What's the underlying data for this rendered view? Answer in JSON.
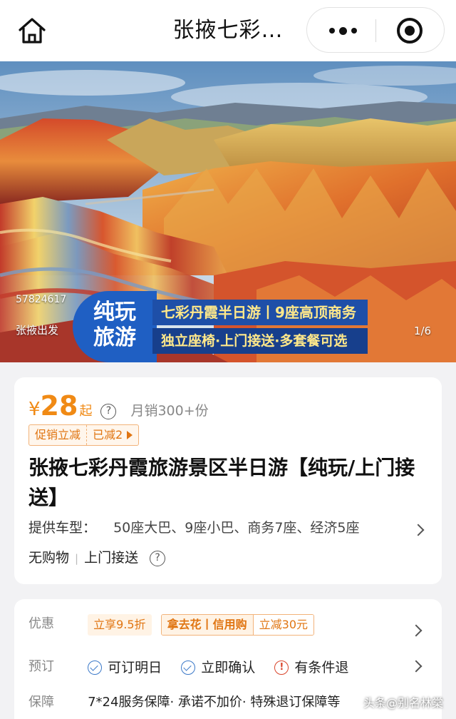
{
  "header": {
    "title": "张掖七彩…",
    "home_icon": "home-icon",
    "more_icon": "more-dots-icon",
    "close_icon": "target-close-icon"
  },
  "hero": {
    "product_id": "57824617",
    "origin": "张掖出发",
    "counter": "1/6",
    "banner": {
      "brand_line1": "纯玩",
      "brand_line2": "旅游",
      "line1": "七彩丹霞半日游丨9座高顶商务",
      "line2": "独立座椅·上门接送·多套餐可选"
    }
  },
  "product": {
    "price_symbol": "¥",
    "price": "28",
    "price_suffix": "起",
    "sales": "月销300+份",
    "promo_label": "促销立减",
    "promo_amount": "已减2",
    "title": "张掖七彩丹霞旅游景区半日游【纯玩/上门接送】",
    "vehicle_label": "提供车型：",
    "vehicle_value": "50座大巴、9座小巴、商务7座、经济5座",
    "features": [
      "无购物",
      "上门接送"
    ]
  },
  "info": {
    "discount_label": "优惠",
    "discount_coupon": "立享9.5折",
    "credit_left": "拿去花丨信用购",
    "credit_right": "立减30元",
    "booking_label": "预订",
    "booking_items": [
      "可订明日",
      "立即确认",
      "有条件退"
    ],
    "guarantee_label": "保障",
    "guarantee_text": "7*24服务保障· 承诺不加价· 特殊退订保障等"
  },
  "watermark": "头条@别名林棠",
  "colors": {
    "accent_orange": "#f08a15",
    "banner_blue": "#1f5fc3",
    "check_blue": "#3a78c8",
    "warn_red": "#d9452b"
  }
}
